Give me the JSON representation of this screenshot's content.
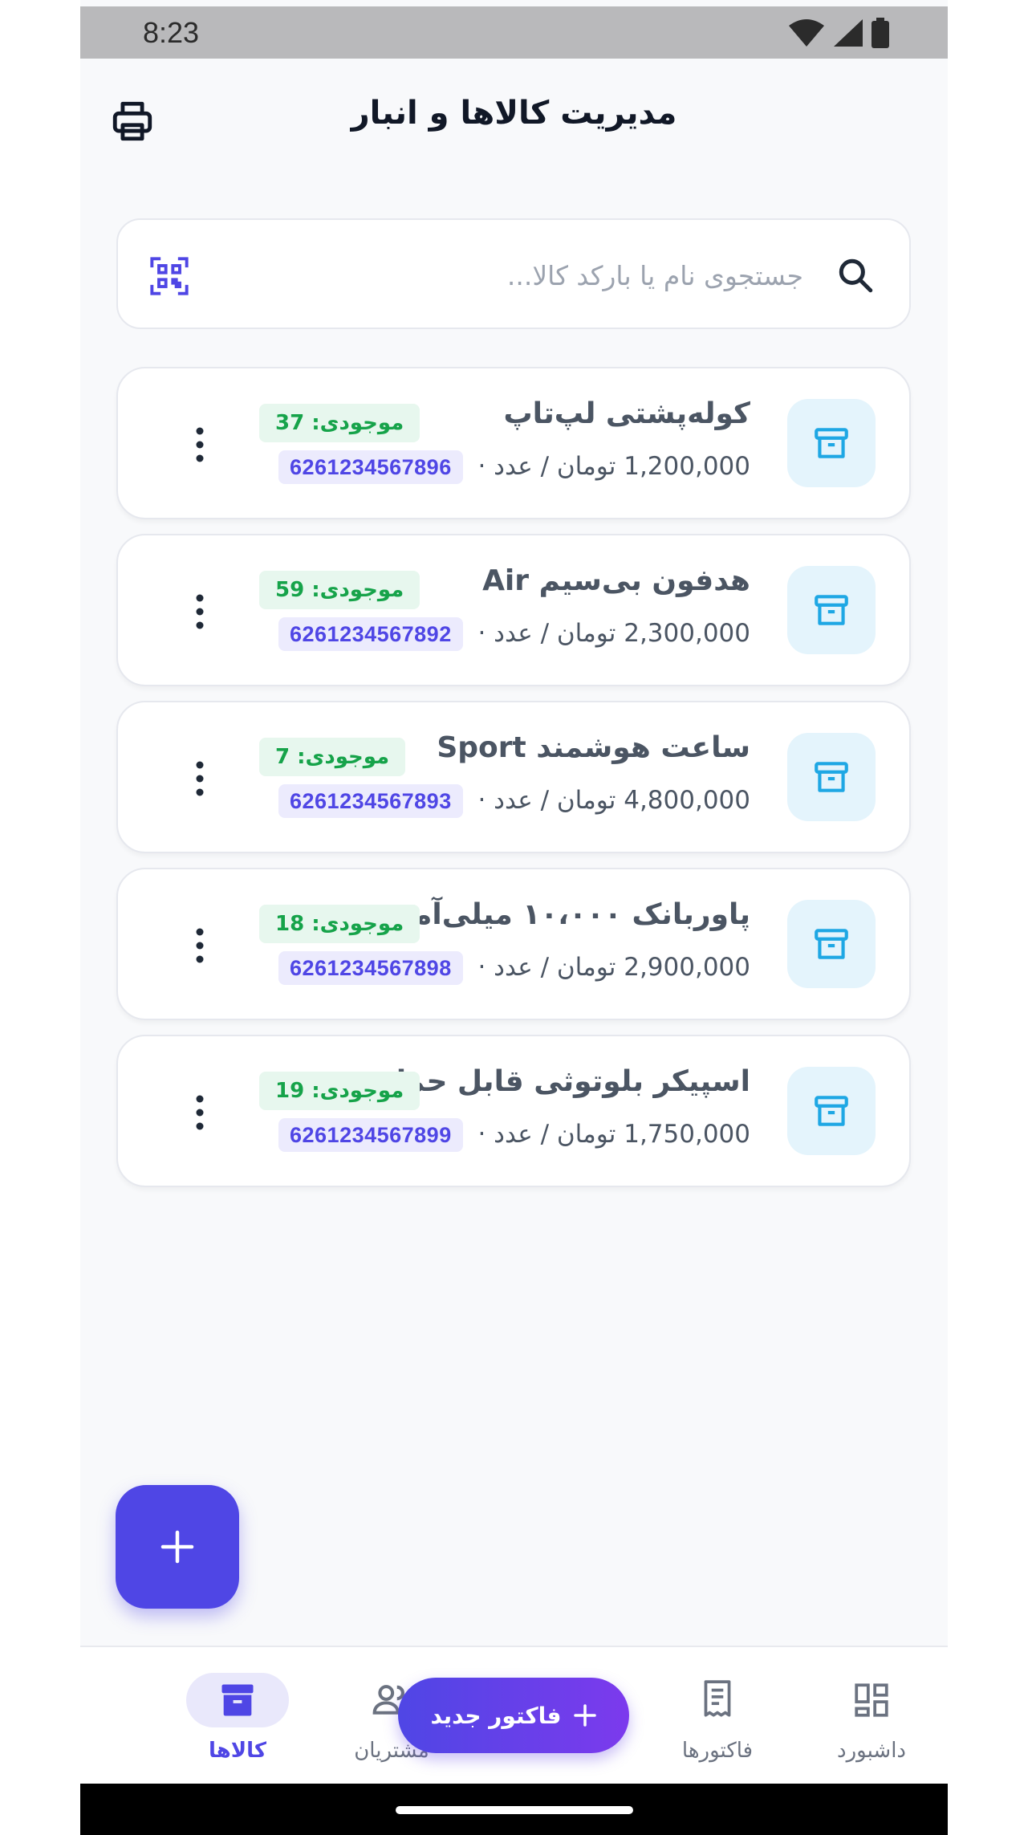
{
  "status_bar": {
    "time": "8:23"
  },
  "header": {
    "title": "مدیریت کالاها و انبار"
  },
  "search": {
    "placeholder": "جستجوی نام یا بارکد کالا..."
  },
  "products": [
    {
      "name": "کوله‌پشتی لپ‌تاپ",
      "stock": "موجودی: 37",
      "price": "1,200,000 تومان / عدد ·",
      "barcode": "6261234567896"
    },
    {
      "name": "هدفون بی‌سیم Air",
      "stock": "موجودی: 59",
      "price": "2,300,000 تومان / عدد ·",
      "barcode": "6261234567892"
    },
    {
      "name": "ساعت هوشمند Sport",
      "stock": "موجودی: 7",
      "price": "4,800,000 تومان / عدد ·",
      "barcode": "6261234567893"
    },
    {
      "name": "پاوربانک ۱۰،۰۰۰ میلی‌آمپر",
      "stock": "موجودی: 18",
      "price": "2,900,000 تومان / عدد ·",
      "barcode": "6261234567898"
    },
    {
      "name": "اسپیکر بلوتوثی قابل حمل",
      "stock": "موجودی: 19",
      "price": "1,750,000 تومان / عدد ·",
      "barcode": "6261234567899"
    }
  ],
  "bottom_nav": {
    "products": "کالاها",
    "customers": "مشتریان",
    "new_invoice": "فاکتور جدید",
    "invoices": "فاکتورها",
    "dashboard": "داشبورد"
  },
  "colors": {
    "accent": "#4f46e5",
    "stock_green": "#16a34a",
    "thumb_bg": "#e4f4fc",
    "icon_blue": "#1ea7e4"
  },
  "icons": [
    "printer-icon",
    "search-icon",
    "qr-code-icon",
    "archive-box-icon",
    "more-vertical-icon",
    "plus-icon",
    "users-icon",
    "receipt-icon",
    "dashboard-icon"
  ]
}
